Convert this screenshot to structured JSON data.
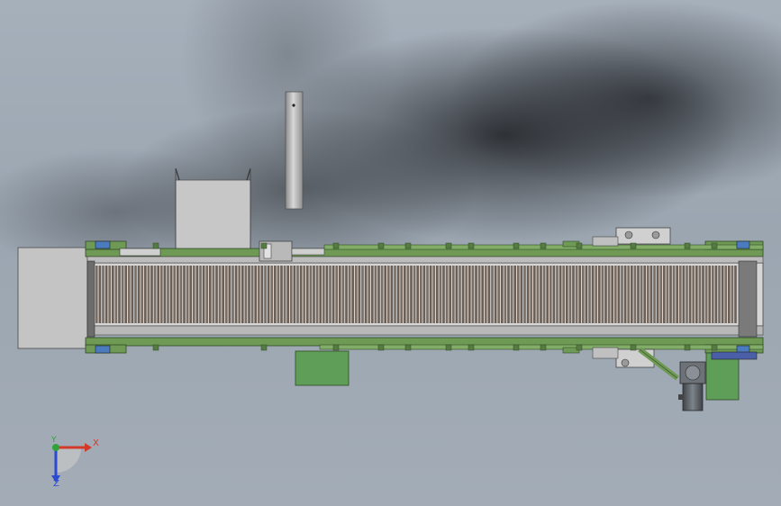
{
  "viewport": {
    "background_color": "#9ba6b1",
    "shadow_color": "#1e2024"
  },
  "model": {
    "frame_color": "#6f9a55",
    "belt_color": "#7a6d63",
    "housing_color": "#c4c4c4",
    "motor_color": "#5a6066",
    "guard_color": "#5f9e58",
    "flange_color": "#4b7bbf"
  },
  "triad": {
    "x_label": "X",
    "y_label": "Y",
    "z_label": "Z",
    "x_color": "#d23a2a",
    "y_color": "#2fa23a",
    "z_color": "#2a4ad2"
  }
}
